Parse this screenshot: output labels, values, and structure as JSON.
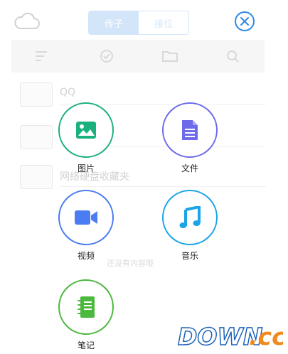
{
  "background_app": {
    "tabs": [
      {
        "label": "传子",
        "active": true
      },
      {
        "label": "接位",
        "active": false
      }
    ],
    "toolbar_icons": [
      "sort-icon",
      "check-icon",
      "folder-icon",
      "search-icon"
    ],
    "rows": [
      {
        "label": "QQ"
      },
      {
        "label": ""
      },
      {
        "label": "网络硬盘收藏夹"
      }
    ],
    "footer_hint": "还没有内容哦"
  },
  "menu": {
    "options": [
      {
        "id": "image",
        "label": "图片",
        "icon": "image-icon",
        "color": "#1bb17e"
      },
      {
        "id": "file",
        "label": "文件",
        "icon": "document-icon",
        "color": "#6e6bea"
      },
      {
        "id": "video",
        "label": "视频",
        "icon": "video-camera-icon",
        "color": "#4b7cf2"
      },
      {
        "id": "music",
        "label": "音乐",
        "icon": "music-note-icon",
        "color": "#1aa5e6"
      },
      {
        "id": "note",
        "label": "笔记",
        "icon": "notebook-icon",
        "color": "#4cb83d"
      }
    ]
  },
  "close_icon": "close-icon",
  "watermark": {
    "text": "DOWN.cc"
  }
}
